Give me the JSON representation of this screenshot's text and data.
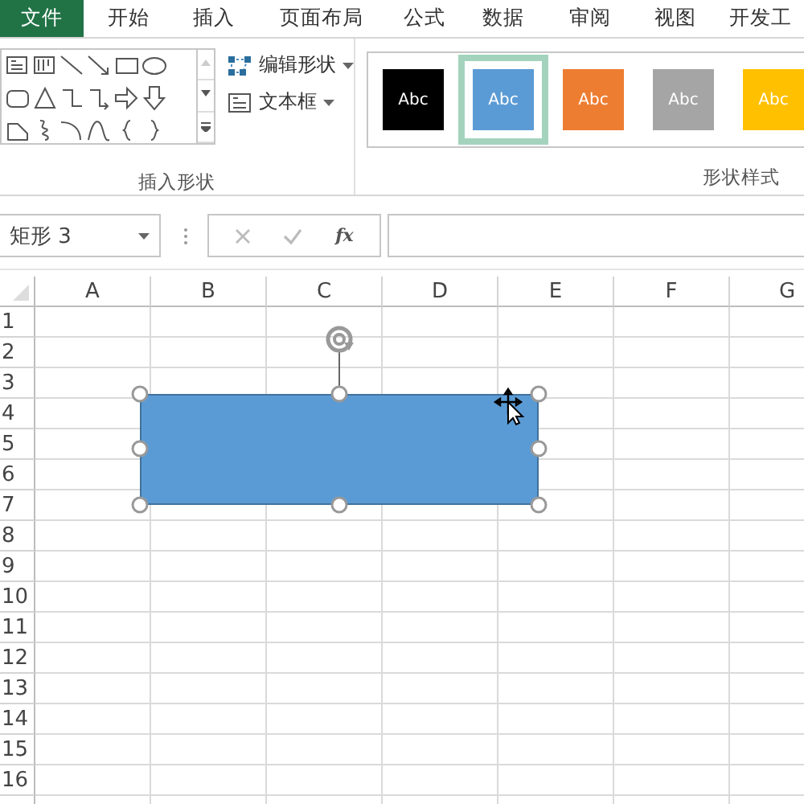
{
  "ribbon_tabs": [
    {
      "label": "文件",
      "kind": "file"
    },
    {
      "label": "开始",
      "kind": "tab"
    },
    {
      "label": "插入",
      "kind": "tab"
    },
    {
      "label": "页面布局",
      "kind": "tab"
    },
    {
      "label": "公式",
      "kind": "tab"
    },
    {
      "label": "数据",
      "kind": "tab"
    },
    {
      "label": "审阅",
      "kind": "tab"
    },
    {
      "label": "视图",
      "kind": "tab"
    },
    {
      "label": "开发工",
      "kind": "tab"
    }
  ],
  "insert_shapes": {
    "commands": [
      {
        "label": "编辑形状",
        "kind": "edit"
      },
      {
        "label": "文本框",
        "kind": "textbox"
      }
    ],
    "group_label": "插入形状"
  },
  "shape_styles": {
    "swatches": [
      {
        "label": "Abc",
        "color": "#000000",
        "selected": false
      },
      {
        "label": "Abc",
        "color": "#5b9bd5",
        "selected": true
      },
      {
        "label": "Abc",
        "color": "#ed7d31",
        "selected": false
      },
      {
        "label": "Abc",
        "color": "#a5a5a5",
        "selected": false
      },
      {
        "label": "Abc",
        "color": "#ffc000",
        "selected": false
      }
    ],
    "group_label": "形状样式"
  },
  "formula_bar": {
    "name_box": "矩形 3",
    "function_label": "fx"
  },
  "sheet": {
    "columns": [
      "A",
      "B",
      "C",
      "D",
      "E",
      "F",
      "G"
    ],
    "rows": [
      "1",
      "2",
      "3",
      "4",
      "5",
      "6",
      "7",
      "8",
      "9",
      "10",
      "11",
      "12",
      "13",
      "14",
      "15",
      "16"
    ],
    "shape": {
      "selected": true
    }
  }
}
